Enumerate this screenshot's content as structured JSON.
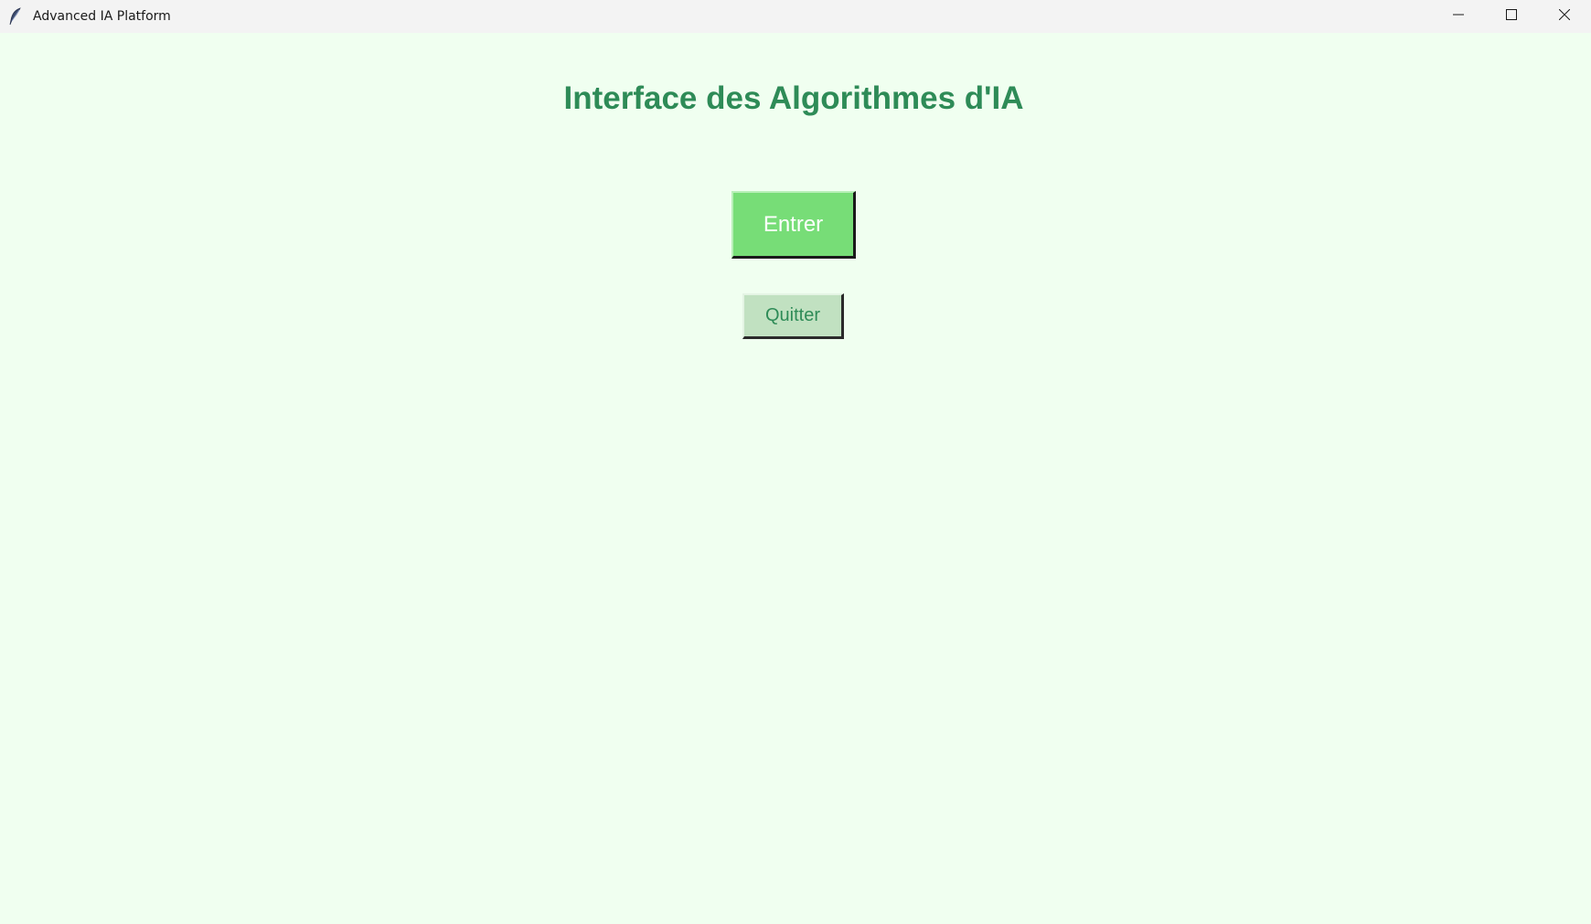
{
  "window": {
    "title": "Advanced IA Platform",
    "icon": "feather-icon",
    "controls": [
      "minimize-icon",
      "maximize-icon",
      "close-icon"
    ]
  },
  "main": {
    "title": "Interface des Algorithmes d'IA",
    "enter_label": "Entrer",
    "quit_label": "Quitter"
  },
  "colors": {
    "background": "#f0fff0",
    "title_text": "#2e8b57",
    "enter_bg": "#77dd77",
    "enter_text": "#ffffff",
    "quit_bg": "#c1e1c1",
    "quit_text": "#2e8b57"
  }
}
